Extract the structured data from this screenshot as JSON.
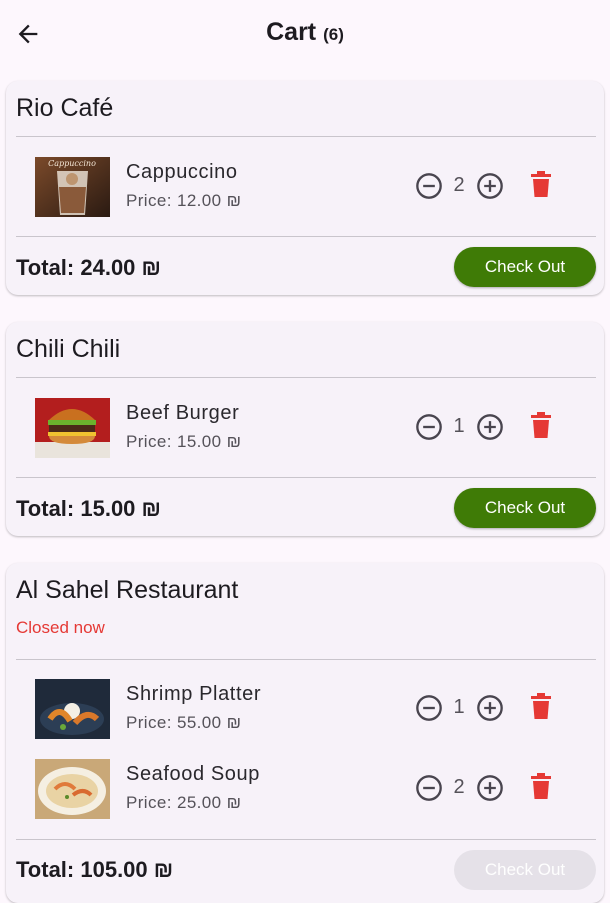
{
  "header": {
    "title": "Cart",
    "count": "(6)"
  },
  "restaurants": [
    {
      "name": "Rio Café",
      "status": "",
      "items": [
        {
          "name": "Cappuccino",
          "price": "Price: 12.00 ₪",
          "qty": "2",
          "image": "cappuccino-photo"
        }
      ],
      "total": "Total: 24.00 ₪",
      "checkout_label": "Check Out",
      "checkout_enabled": true
    },
    {
      "name": "Chili Chili",
      "status": "",
      "items": [
        {
          "name": "Beef Burger",
          "price": "Price: 15.00 ₪",
          "qty": "1",
          "image": "burger-photo"
        }
      ],
      "total": "Total: 15.00 ₪",
      "checkout_label": "Check Out",
      "checkout_enabled": true
    },
    {
      "name": "Al Sahel Restaurant",
      "status": "Closed now",
      "items": [
        {
          "name": "Shrimp Platter",
          "price": "Price: 55.00 ₪",
          "qty": "1",
          "image": "shrimp-photo"
        },
        {
          "name": "Seafood Soup",
          "price": "Price: 25.00 ₪",
          "qty": "2",
          "image": "soup-photo"
        }
      ],
      "total": "Total: 105.00 ₪",
      "checkout_label": "Check Out",
      "checkout_enabled": false
    }
  ],
  "icons": {
    "back": "arrow-left-icon",
    "minus": "minus-circle-icon",
    "plus": "plus-circle-icon",
    "delete": "trash-icon"
  },
  "colors": {
    "checkout": "#3f7b06",
    "checkout_disabled": "#e5e1e8",
    "delete": "#e53935",
    "closed": "#e53935",
    "background": "#fdf7fd",
    "card": "#f7f2f9"
  }
}
